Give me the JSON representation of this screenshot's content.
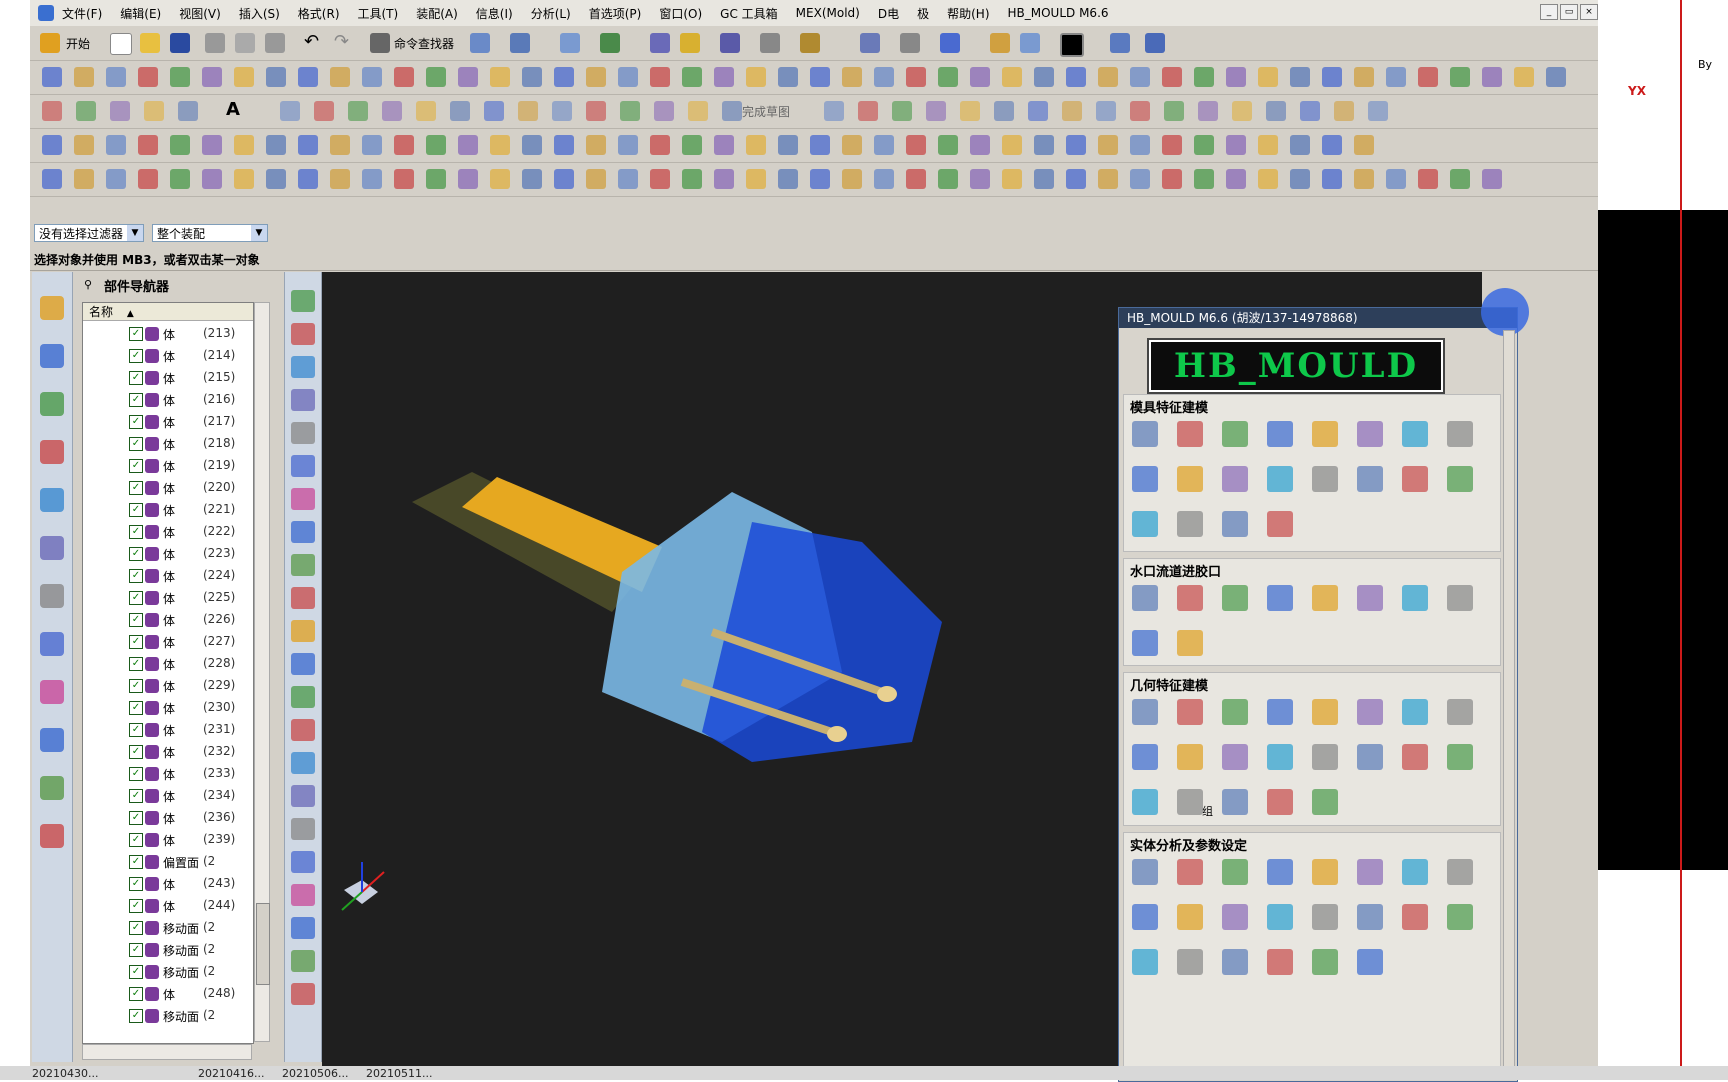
{
  "menu": {
    "items": [
      "文件(F)",
      "编辑(E)",
      "视图(V)",
      "插入(S)",
      "格式(R)",
      "工具(T)",
      "装配(A)",
      "信息(I)",
      "分析(L)",
      "首选项(P)",
      "窗口(O)",
      "GC 工具箱",
      "MEX(Mold)",
      "D电",
      "极",
      "帮助(H)",
      "HB_MOULD M6.6"
    ]
  },
  "toolbar": {
    "start_label": "开始",
    "cmd_finder_label": "命令查找器",
    "finish_sketch_label": "完成草图"
  },
  "filters": {
    "selection_filter": "没有选择过滤器",
    "assembly_scope": "整个装配"
  },
  "status": {
    "prompt": "选择对象并使用 MB3，或者双击某一对象"
  },
  "navigator": {
    "title": "部件导航器",
    "column_name": "名称",
    "rows": [
      {
        "name": "体",
        "num": "(213)"
      },
      {
        "name": "体",
        "num": "(214)"
      },
      {
        "name": "体",
        "num": "(215)"
      },
      {
        "name": "体",
        "num": "(216)"
      },
      {
        "name": "体",
        "num": "(217)"
      },
      {
        "name": "体",
        "num": "(218)"
      },
      {
        "name": "体",
        "num": "(219)"
      },
      {
        "name": "体",
        "num": "(220)"
      },
      {
        "name": "体",
        "num": "(221)"
      },
      {
        "name": "体",
        "num": "(222)"
      },
      {
        "name": "体",
        "num": "(223)"
      },
      {
        "name": "体",
        "num": "(224)"
      },
      {
        "name": "体",
        "num": "(225)"
      },
      {
        "name": "体",
        "num": "(226)"
      },
      {
        "name": "体",
        "num": "(227)"
      },
      {
        "name": "体",
        "num": "(228)"
      },
      {
        "name": "体",
        "num": "(229)"
      },
      {
        "name": "体",
        "num": "(230)"
      },
      {
        "name": "体",
        "num": "(231)"
      },
      {
        "name": "体",
        "num": "(232)"
      },
      {
        "name": "体",
        "num": "(233)"
      },
      {
        "name": "体",
        "num": "(234)"
      },
      {
        "name": "体",
        "num": "(236)"
      },
      {
        "name": "体",
        "num": "(239)"
      },
      {
        "name": "偏置面",
        "num": "(2"
      },
      {
        "name": "体",
        "num": "(243)"
      },
      {
        "name": "体",
        "num": "(244)"
      },
      {
        "name": "移动面",
        "num": "(2"
      },
      {
        "name": "移动面",
        "num": "(2"
      },
      {
        "name": "移动面",
        "num": "(2"
      },
      {
        "name": "体",
        "num": "(248)"
      },
      {
        "name": "移动面",
        "num": "(2"
      }
    ]
  },
  "mould_panel": {
    "title": "HB_MOULD M6.6 (胡波/137-14978868)",
    "logo_text": "HB_MOULD",
    "sections": [
      "模具特征建模",
      "水口流道进胶口",
      "几何特征建模",
      "实体分析及参数设定"
    ],
    "group_label": "组",
    "yx_label": "YX",
    "by_label": "By"
  },
  "taskbar": {
    "items": [
      "20210430...",
      "20210416...",
      "20210506...",
      "20210511..."
    ]
  },
  "colors": {
    "viewport_bg": "#1f1f1f",
    "logo_green": "#0ec84a",
    "mould_blue": "#1a4ad8",
    "mould_light": "#7ab8e6",
    "sprue_yellow": "#e6a820",
    "title_dark": "#2d3f5a"
  }
}
